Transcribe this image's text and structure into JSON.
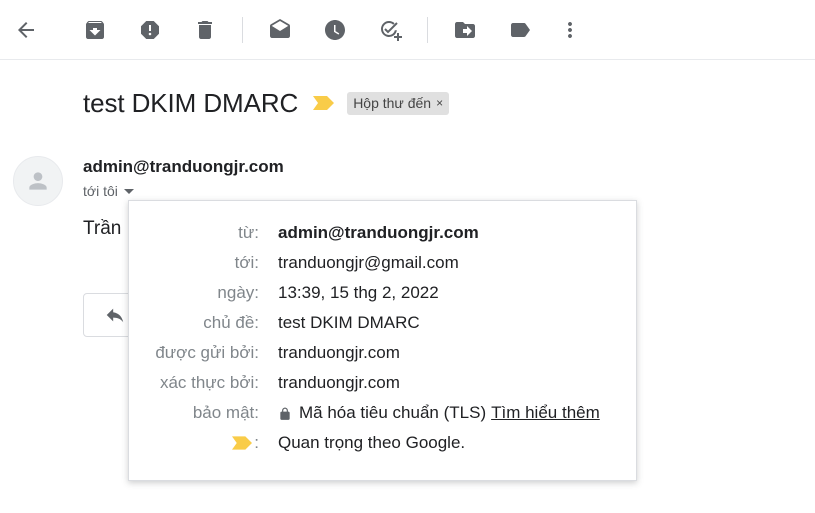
{
  "toolbar": {
    "buttons": [
      {
        "icon": "arrow-back-icon"
      },
      {
        "icon": "archive-icon"
      },
      {
        "icon": "report-spam-icon"
      },
      {
        "icon": "delete-icon"
      },
      {
        "icon": "mark-unread-icon"
      },
      {
        "icon": "snooze-icon"
      },
      {
        "icon": "add-to-tasks-icon"
      },
      {
        "icon": "move-to-icon"
      },
      {
        "icon": "label-icon"
      },
      {
        "icon": "more-vert-icon"
      }
    ]
  },
  "message": {
    "subject": "test DKIM DMARC",
    "label_chip": "Hộp thư đến",
    "label_close": "×",
    "sender": "admin@tranduongjr.com",
    "recipient_summary": "tới tôi",
    "body_preview": "Trần"
  },
  "details": {
    "rows": [
      {
        "label": "từ:",
        "value": "admin@tranduongjr.com"
      },
      {
        "label": "tới:",
        "value": "tranduongjr@gmail.com"
      },
      {
        "label": "ngày:",
        "value": "13:39, 15 thg 2, 2022"
      },
      {
        "label": "chủ đề:",
        "value": "test DKIM DMARC"
      },
      {
        "label": "được gửi bởi:",
        "value": "tranduongjr.com"
      },
      {
        "label": "xác thực bởi:",
        "value": "tranduongjr.com"
      },
      {
        "label": "bảo mật:",
        "value": "Mã hóa tiêu chuẩn (TLS)",
        "link": "Tìm hiểu thêm"
      },
      {
        "label": ":",
        "value": "Quan trọng theo Google."
      }
    ]
  },
  "colors": {
    "importance_marker": "#f9cc48",
    "icon_gray": "#5f6368",
    "chip_bg": "#e0e0e0"
  }
}
